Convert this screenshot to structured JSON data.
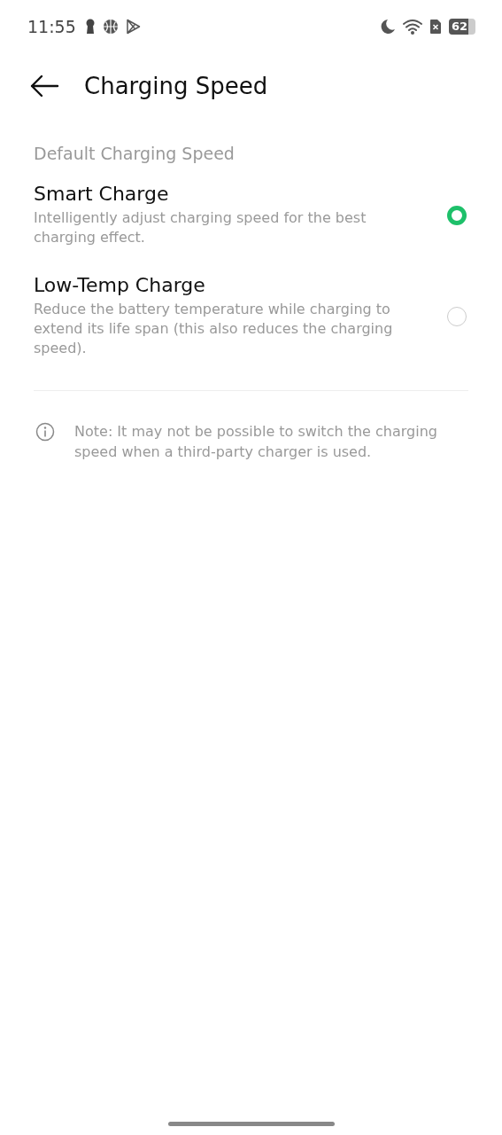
{
  "status_bar": {
    "time": "11:55",
    "battery": "62"
  },
  "header": {
    "title": "Charging Speed"
  },
  "section_label": "Default Charging Speed",
  "options": [
    {
      "title": "Smart Charge",
      "description": "Intelligently adjust charging speed for the best charging effect.",
      "selected": true
    },
    {
      "title": "Low-Temp Charge",
      "description": "Reduce the battery temperature while charging to extend its life span (this also reduces the charging speed).",
      "selected": false
    }
  ],
  "note": "Note: It may not be possible to switch the charging speed when a third-party charger is used."
}
